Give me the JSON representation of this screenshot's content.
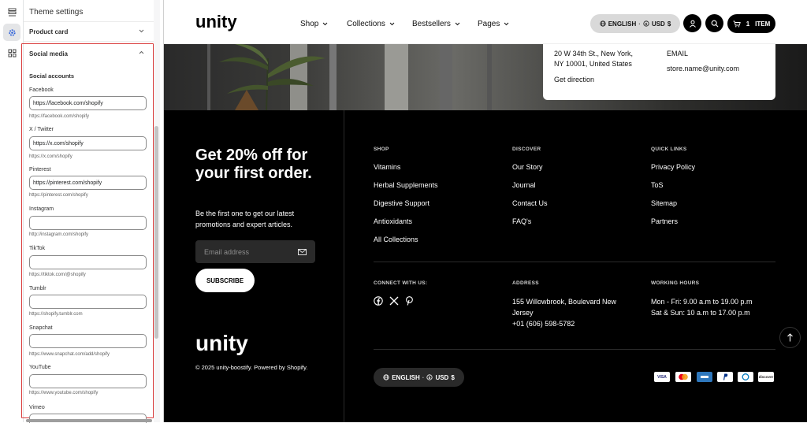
{
  "panel": {
    "title": "Theme settings",
    "product_card_label": "Product card",
    "social_media_label": "Social media",
    "social_accounts_heading": "Social accounts",
    "fields": [
      {
        "label": "Facebook",
        "value": "https://facebook.com/shopify",
        "help": "https://facebook.com/shopify"
      },
      {
        "label": "X / Twitter",
        "value": "https://x.com/shopify",
        "help": "https://x.com/shopify"
      },
      {
        "label": "Pinterest",
        "value": "https://pinterest.com/shopify",
        "help": "https://pinterest.com/shopify"
      },
      {
        "label": "Instagram",
        "value": "",
        "help": "http://instagram.com/shopify"
      },
      {
        "label": "TikTok",
        "value": "",
        "help": "https://tiktok.com/@shopify"
      },
      {
        "label": "Tumblr",
        "value": "",
        "help": "https://shopify.tumblr.com"
      },
      {
        "label": "Snapchat",
        "value": "",
        "help": "https://www.snapchat.com/add/shopify"
      },
      {
        "label": "YouTube",
        "value": "",
        "help": "https://www.youtube.com/shopify"
      },
      {
        "label": "Vimeo",
        "value": "",
        "help": ""
      }
    ]
  },
  "header": {
    "nav": [
      "Shop",
      "Collections",
      "Bestsellers",
      "Pages"
    ],
    "language": "ENGLISH",
    "currency": "USD",
    "currency_symbol": "$",
    "cart_count": "1",
    "cart_label": "ITEM"
  },
  "contact_card": {
    "address_line1": "20 W 34th St., New York,",
    "address_line2": "NY 10001, United States",
    "direction_link": "Get direction",
    "email_label": "EMAIL",
    "email_value": "store.name@unity.com"
  },
  "footer": {
    "promo_title": "Get 20% off for your first order.",
    "promo_subtitle": "Be the first one to get our latest promotions and expert articles.",
    "email_placeholder": "Email address",
    "subscribe_label": "SUBSCRIBE",
    "copyright": "© 2025 unity-boostify. Powered by Shopify.",
    "columns": [
      {
        "heading": "SHOP",
        "links": [
          "Vitamins",
          "Herbal Supplements",
          "Digestive Support",
          "Antioxidants",
          "All Collections"
        ]
      },
      {
        "heading": "DISCOVER",
        "links": [
          "Our Story",
          "Journal",
          "Contact Us",
          "FAQ's"
        ]
      },
      {
        "heading": "QUICK LINKS",
        "links": [
          "Privacy Policy",
          "ToS",
          "Sitemap",
          "Partners"
        ]
      }
    ],
    "connect_heading": "CONNECT WITH US:",
    "address_heading": "ADDRESS",
    "address_line1": "155 Willowbrook, Boulevard New",
    "address_line2": "Jersey",
    "address_phone": "+01 (606) 598-5782",
    "hours_heading": "WORKING HOURS",
    "hours_line1": "Mon - Fri: 9.00 a.m to 19.00 p.m",
    "hours_line2": "Sat & Sun: 10 a.m to 17.00 p.m",
    "language": "ENGLISH",
    "currency": "USD",
    "currency_symbol": "$",
    "payments": [
      "VISA",
      "mastercard",
      "amex",
      "paypal",
      "diners",
      "discover"
    ]
  },
  "brand": {
    "logo_text": "unity"
  },
  "colors": {
    "highlight_border": "#d93a3a",
    "footer_bg": "#000000",
    "pill_bg": "#d9d9d9"
  }
}
